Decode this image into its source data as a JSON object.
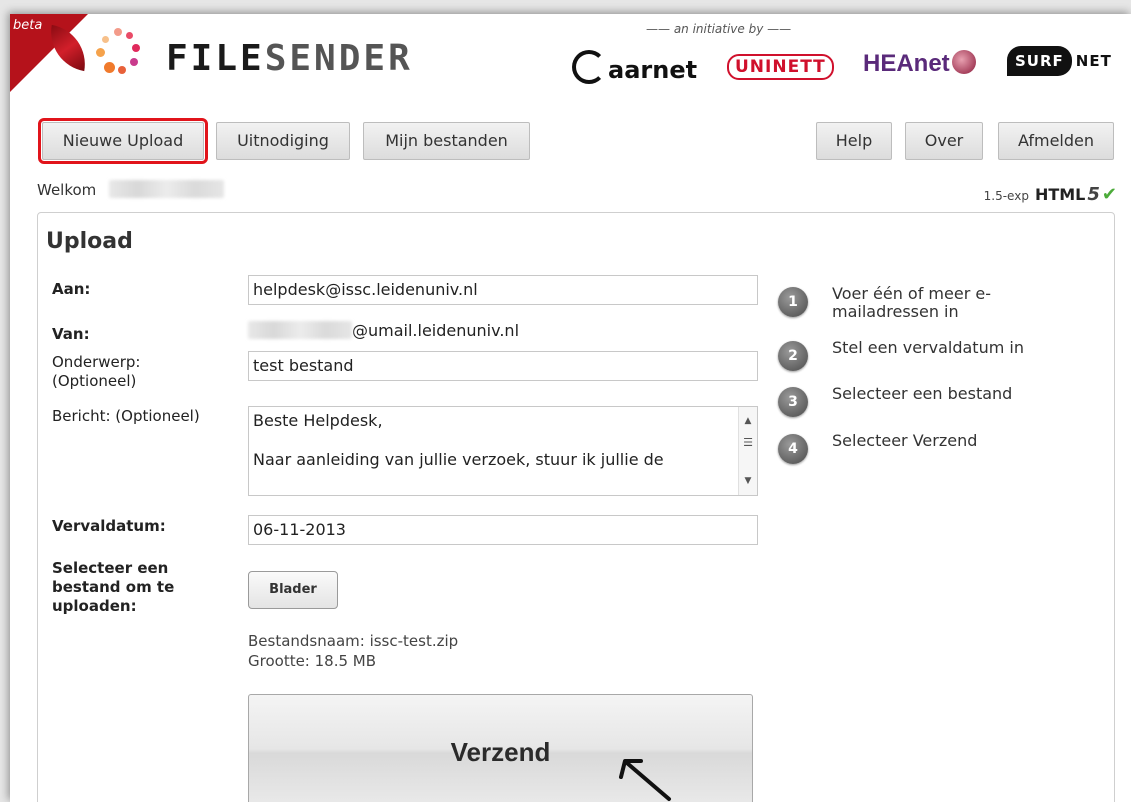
{
  "header": {
    "beta": "beta",
    "logo_main": "FILE",
    "logo_sub": "SENDER",
    "initiative": "—— an initiative by ——",
    "partners": {
      "aarnet": "aarnet",
      "uninett": "UNINETT",
      "heanet": "HEAnet",
      "surf": "SURF",
      "net": "NET"
    }
  },
  "nav": {
    "new_upload": "Nieuwe Upload",
    "invitation": "Uitnodiging",
    "my_files": "Mijn bestanden",
    "help": "Help",
    "about": "Over",
    "logout": "Afmelden"
  },
  "welcome": "Welkom",
  "version": {
    "label": "1.5-exp",
    "html": "HTML",
    "five": "5",
    "check": "✔"
  },
  "form": {
    "title": "Upload",
    "to_label": "Aan:",
    "to_value": "helpdesk@issc.leidenuniv.nl",
    "from_label": "Van:",
    "from_value": "@umail.leidenuniv.nl",
    "subject_label_1": "Onderwerp:",
    "subject_label_2": "(Optioneel)",
    "subject_value": "test bestand",
    "message_label": "Bericht: (Optioneel)",
    "message_line1": "Beste Helpdesk,",
    "message_line2": "Naar aanleiding van jullie verzoek, stuur ik jullie de",
    "expiry_label": "Vervaldatum:",
    "expiry_value": "06-11-2013",
    "select_label_1": "Selecteer een",
    "select_label_2": "bestand om te",
    "select_label_3": "uploaden:",
    "browse": "Blader",
    "filename": "Bestandsnaam: issc-test.zip",
    "filesize": "Grootte: 18.5 MB",
    "send": "Verzend"
  },
  "steps": [
    {
      "num": "1",
      "line1": "Voer één of meer e-",
      "line2": "mailadressen in"
    },
    {
      "num": "2",
      "line1": "Stel een vervaldatum in"
    },
    {
      "num": "3",
      "line1": "Selecteer een bestand"
    },
    {
      "num": "4",
      "line1": "Selecteer Verzend"
    }
  ]
}
